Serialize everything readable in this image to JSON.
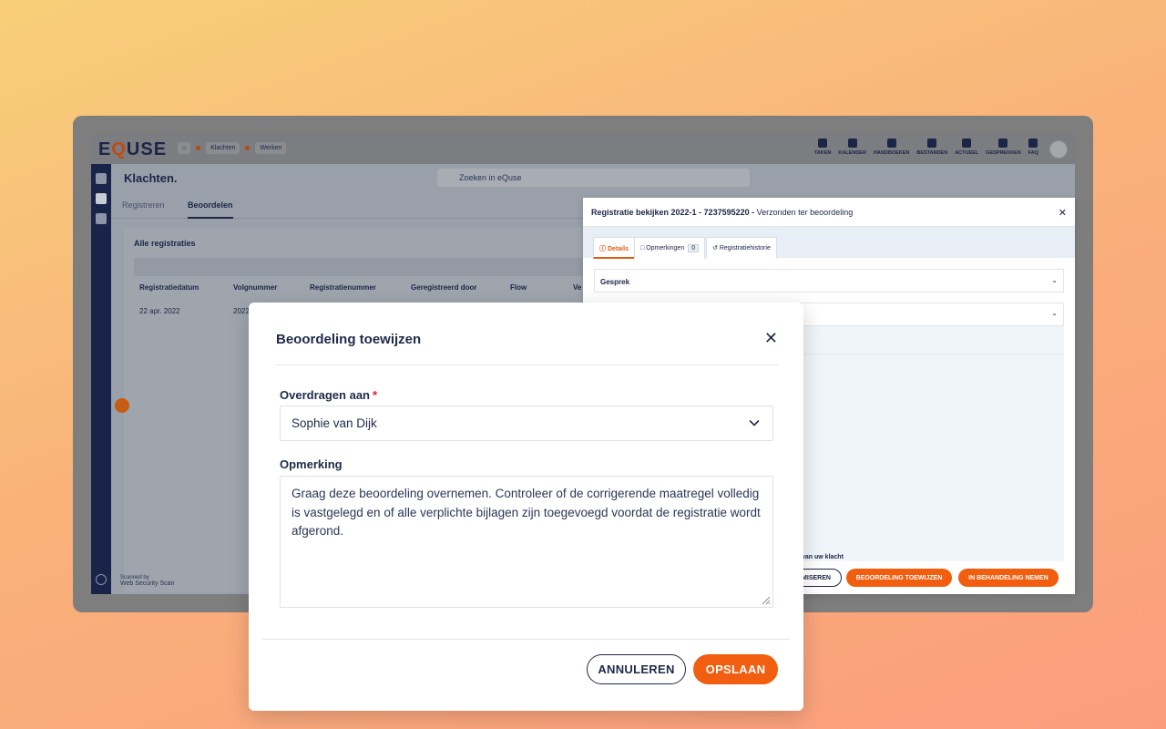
{
  "app": {
    "logo": "EQUSE",
    "breadcrumb": {
      "module": "Klachten",
      "action": "Werken"
    },
    "topnav": [
      {
        "label": "TAKEN",
        "icon": "clipboard-icon"
      },
      {
        "label": "KALENDER",
        "icon": "calendar-icon"
      },
      {
        "label": "HANDBOEKEN",
        "icon": "book-icon"
      },
      {
        "label": "BESTANDEN",
        "icon": "archive-icon"
      },
      {
        "label": "ACTUEEL",
        "icon": "news-icon"
      },
      {
        "label": "GESPREKKEN",
        "icon": "chat-icon"
      },
      {
        "label": "FAQ",
        "icon": "question-icon"
      }
    ],
    "page_title": "Klachten.",
    "search_placeholder": "Zoeken in eQuse",
    "tabs": [
      "Registreren",
      "Beoordelen"
    ],
    "panel_title": "Alle registraties",
    "table": {
      "headers": [
        "Registratiedatum",
        "Volgnummer",
        "Registratienummer",
        "Geregistreerd door",
        "Flow",
        "Ve"
      ],
      "rows": [
        [
          "22 apr. 2022",
          "2022"
        ]
      ]
    },
    "scanned_by": "Scanned by",
    "scanner_name": "Web Security Scan"
  },
  "registration_panel": {
    "title_bold": "Registratie bekijken 2022-1 - 7237595220 -",
    "title_status": "Verzonden ter beoordeling",
    "tabs": [
      {
        "label": "Details",
        "icon": "info-icon"
      },
      {
        "label": "Opmerkingen",
        "icon": "comments-icon",
        "count": "0"
      },
      {
        "label": "Registratiehistorie",
        "icon": "history-icon"
      }
    ],
    "accordion_gesprek": "Gesprek",
    "klacht_label": "van uw klacht",
    "buttons": [
      "MISEREN",
      "BEOORDELING TOEWIJZEN",
      "IN BEHANDELING NEMEN"
    ]
  },
  "modal": {
    "title": "Beoordeling toewijzen",
    "transfer_label": "Overdragen aan",
    "required_mark": "*",
    "transfer_value": "Sophie van Dijk",
    "remark_label": "Opmerking",
    "remark_value": "Graag deze beoordeling overnemen. Controleer of de corrigerende maatregel volledig is vastgelegd en of alle verplichte bijlagen zijn toegevoegd voordat de registratie wordt afgerond.",
    "cancel_label": "ANNULEREN",
    "save_label": "OPSLAAN"
  },
  "colors": {
    "accent": "#f15e0f",
    "navy": "#1f2a4a"
  }
}
